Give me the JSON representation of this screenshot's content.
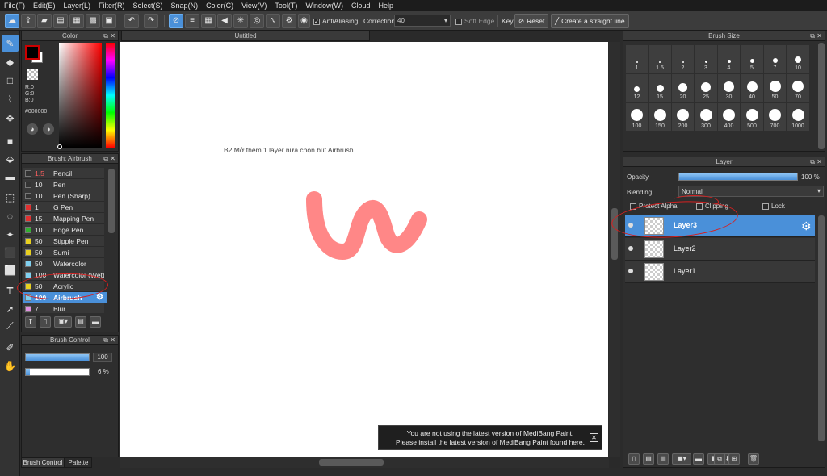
{
  "menu": [
    "File(F)",
    "Edit(E)",
    "Layer(L)",
    "Filter(R)",
    "Select(S)",
    "Snap(N)",
    "Color(C)",
    "View(V)",
    "Tool(T)",
    "Window(W)",
    "Cloud",
    "Help"
  ],
  "toolbar": {
    "antialias_label": "AntiAliasing",
    "correction_label": "Correction",
    "correction_value": "40",
    "soft_edge_label": "Soft Edge",
    "key_label": "Key",
    "reset_label": "Reset",
    "straight_line_label": "Create a straight line"
  },
  "color_panel": {
    "title": "Color",
    "r": "R:0",
    "g": "G:0",
    "b": "B:0",
    "hex": "#000000",
    "primary_color": "#000000",
    "secondary_color": "#ffffff"
  },
  "brush_panel": {
    "title": "Brush: Airbrush",
    "items": [
      {
        "size": "1.5",
        "name": "Pencil",
        "color": "#333333",
        "size_color": "#ff6060"
      },
      {
        "size": "10",
        "name": "Pen",
        "color": "#333333"
      },
      {
        "size": "10",
        "name": "Pen (Sharp)",
        "color": "#333333"
      },
      {
        "size": "1",
        "name": "G Pen",
        "color": "#e03030"
      },
      {
        "size": "15",
        "name": "Mapping Pen",
        "color": "#e03030"
      },
      {
        "size": "10",
        "name": "Edge Pen",
        "color": "#30b030"
      },
      {
        "size": "50",
        "name": "Stipple Pen",
        "color": "#e8d020"
      },
      {
        "size": "50",
        "name": "Sumi",
        "color": "#e8d020"
      },
      {
        "size": "50",
        "name": "Watercolor",
        "color": "#80d0f0"
      },
      {
        "size": "100",
        "name": "Watercolor (Wet)",
        "color": "#80d0f0"
      },
      {
        "size": "50",
        "name": "Acrylic",
        "color": "#e8d020"
      },
      {
        "size": "100",
        "name": "Airbrush",
        "color": "#80d0f0"
      },
      {
        "size": "7",
        "name": "Blur",
        "color": "#e090e0"
      }
    ],
    "selected_index": 11
  },
  "brush_control": {
    "title": "Brush Control",
    "size_value": "100",
    "opacity_value": "6 %",
    "size_fraction": 1.0,
    "opacity_fraction": 0.06
  },
  "bottom_tabs": [
    "Brush Control",
    "Palette"
  ],
  "canvas": {
    "title": "Untitled",
    "annotation": "B2.Mở thêm 1 layer nữa chọn bút Airbrush",
    "stroke_color": "#ff7a7a"
  },
  "toast": {
    "line1": "You are not using the latest version of MediBang Paint.",
    "line2": "Please install the latest version of MediBang Paint found here."
  },
  "brush_size_panel": {
    "title": "Brush Size",
    "sizes": [
      "1",
      "1.5",
      "2",
      "3",
      "4",
      "5",
      "7",
      "10",
      "12",
      "15",
      "20",
      "25",
      "30",
      "40",
      "50",
      "70",
      "100",
      "150",
      "200",
      "300",
      "400",
      "500",
      "700",
      "1000"
    ]
  },
  "layer_panel": {
    "title": "Layer",
    "opacity_label": "Opacity",
    "opacity_value": "100 %",
    "blending_label": "Blending",
    "blending_value": "Normal",
    "protect_alpha_label": "Protect Alpha",
    "clipping_label": "Clipping",
    "lock_label": "Lock",
    "layers": [
      {
        "name": "Layer3"
      },
      {
        "name": "Layer2"
      },
      {
        "name": "Layer1"
      }
    ],
    "selected_index": 0
  }
}
